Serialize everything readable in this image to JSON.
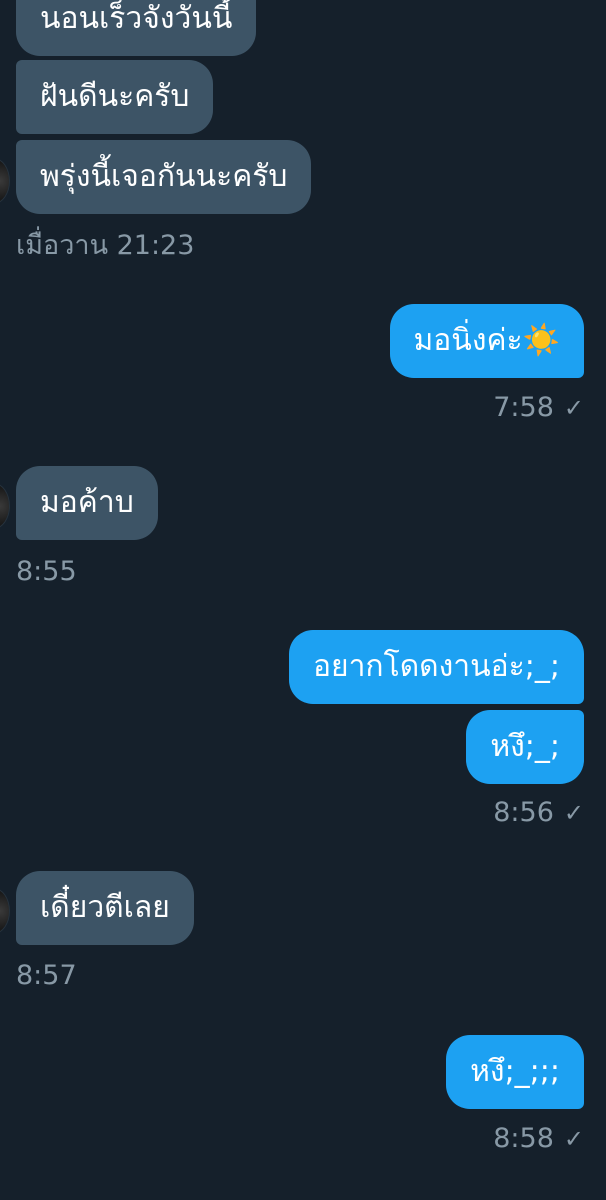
{
  "conversation": {
    "group1": {
      "messages": [
        "นอนเร็วจังวันนี้",
        "ฝันดีนะครับ",
        "พรุ่งนี้เจอกันนะครับ"
      ],
      "time": "เมื่อวาน 21:23"
    },
    "group2": {
      "messages": [
        "มอนิ่งค่ะ☀️"
      ],
      "time": "7:58"
    },
    "group3": {
      "messages": [
        "มอค้าบ"
      ],
      "time": "8:55"
    },
    "group4": {
      "messages": [
        "อยากโดดงานอ่ะ;_;",
        "หงึ;_;"
      ],
      "time": "8:56"
    },
    "group5": {
      "messages": [
        "เดี๋ยวตีเลย"
      ],
      "time": "8:57"
    },
    "group6": {
      "messages": [
        "หงึ;_;;;"
      ],
      "time": "8:58"
    }
  },
  "icons": {
    "sent_check": "✓"
  },
  "colors": {
    "background": "#15202b",
    "incoming_bubble": "#3d5466",
    "outgoing_bubble": "#1da1f2",
    "meta_text": "#8899a6"
  }
}
